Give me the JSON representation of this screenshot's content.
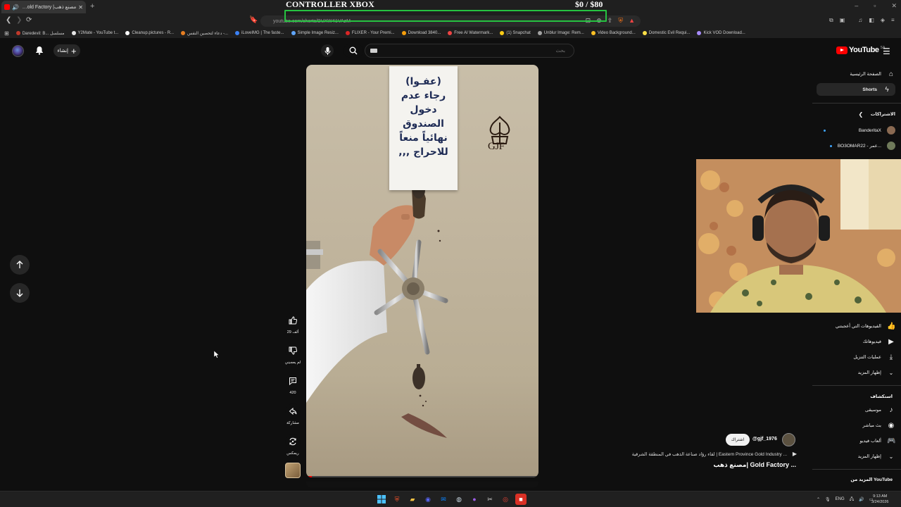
{
  "browser": {
    "tab_title": "مصنع ذهب| Gold Factory ...",
    "url": "youtube.com/shorts/BUXW41VAzM",
    "bookmarks": [
      {
        "label": "Daredevil: B... مسلسل",
        "color": "#c0392b"
      },
      {
        "label": "Y2Mate - YouTube t...",
        "color": "#e6e6e6"
      },
      {
        "label": "Cleanup.pictures - R...",
        "color": "#ffffff"
      },
      {
        "label": "دعاء لتحصين النفس -...",
        "color": "#e67e22"
      },
      {
        "label": "iLoveIMG | The faste...",
        "color": "#3b82f6"
      },
      {
        "label": "Simple Image Resiz...",
        "color": "#60a5fa"
      },
      {
        "label": "FLIXER - Your Premi...",
        "color": "#dc2626"
      },
      {
        "label": "Download 3840...",
        "color": "#f59e0b"
      },
      {
        "label": "Free AI Watermark...",
        "color": "#ef4444"
      },
      {
        "label": "(1) Snapchat",
        "color": "#facc15"
      },
      {
        "label": "Unblur Image: Rem...",
        "color": "#a3a3a3"
      },
      {
        "label": "Video Background...",
        "color": "#fbbf24"
      },
      {
        "label": "Domestic Evil Requi...",
        "color": "#fde047"
      },
      {
        "label": "Kick VOD Download...",
        "color": "#a78bfa"
      }
    ]
  },
  "overlay": {
    "title": "CONTROLLER XBOX",
    "money": "$0  / $80"
  },
  "header": {
    "create_label": "إنشاء",
    "search_placeholder": "بحث",
    "logo_text": "YouTube",
    "logo_country": "SA"
  },
  "sidebar": {
    "home": "الصفحة الرئيسية",
    "shorts": "Shorts",
    "subscriptions": "الاشتراكات",
    "channels": [
      "BanderitaX",
      "BO3OMAR22 - عمر..."
    ],
    "liked": "الفيديوهات التي أعجبتني",
    "your_videos": "فيديوهاتك",
    "downloads": "عمليات التنزيل",
    "show_more": "إظهار المزيد",
    "explore": "استكشاف",
    "music": "موسيقى",
    "live": "بث مباشر",
    "gaming": "ألعاب فيديو",
    "show_more2": "إظهار المزيد",
    "more_from": "المزيد من YouTube"
  },
  "video": {
    "sign_lines": [
      "(عفـوا)",
      "رجاء عدم",
      "دخول الصندوق",
      "نهائياً منعاً",
      "للاحراج ,,,"
    ],
    "watermark": "GJF"
  },
  "actions": {
    "likes": "29 ألف",
    "dislike": "لم يعجبني",
    "comments": "420",
    "share": "مشاركة",
    "remix": "ريمكس"
  },
  "info": {
    "subscribe": "اشتراك",
    "handle": "@gjf_1976",
    "sound": "لقاء رؤاد صناعة الذهب في المنطقة الشرقية | Eastern Province Gold Industry ...",
    "title": "مصنع ذهب| Gold Factory ..."
  },
  "taskbar": {
    "lang": "ENG",
    "time": "9:13 AM",
    "date": "3/24/2026"
  },
  "colors": {
    "accent": "#ff0000",
    "overlay_green": "#26c241",
    "bg": "#0f0f0f"
  }
}
